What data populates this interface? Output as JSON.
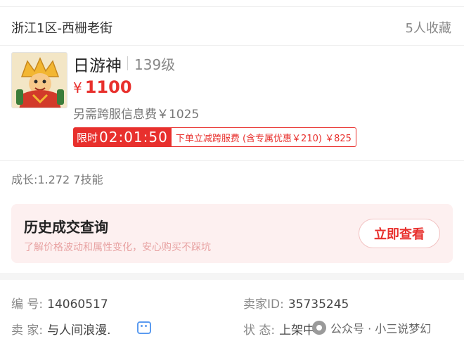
{
  "header": {
    "server": "浙江1区-西栅老街",
    "favorites": "5人收藏"
  },
  "character": {
    "name": "日游神",
    "level": "139级",
    "currency": "¥",
    "price": "1100",
    "cross_server_fee": "另需跨服信息费￥1025"
  },
  "promo": {
    "timer_label": "限时",
    "timer_value": "02:01:50",
    "discount_text": "下单立减跨服费 (含专属优惠￥210) ￥825"
  },
  "stats": {
    "growth": "成长:1.272 7技能"
  },
  "history": {
    "title": "历史成交查询",
    "subtitle": "了解价格波动和属性变化，安心购买不踩坑",
    "button": "立即查看"
  },
  "details": {
    "serial_label": "编  号:",
    "serial_value": "14060517",
    "seller_id_label": "卖家ID:",
    "seller_id_value": "35735245",
    "seller_label": "卖  家:",
    "seller_value": "与人间浪漫.",
    "status_label": "状  态:",
    "status_value": "上架中"
  },
  "watermark": {
    "text": "公众号 · 小三说梦幻"
  },
  "colors": {
    "accent": "#e8302d",
    "history_bg": "#fdf0f0",
    "link_blue": "#5b9bf0"
  }
}
